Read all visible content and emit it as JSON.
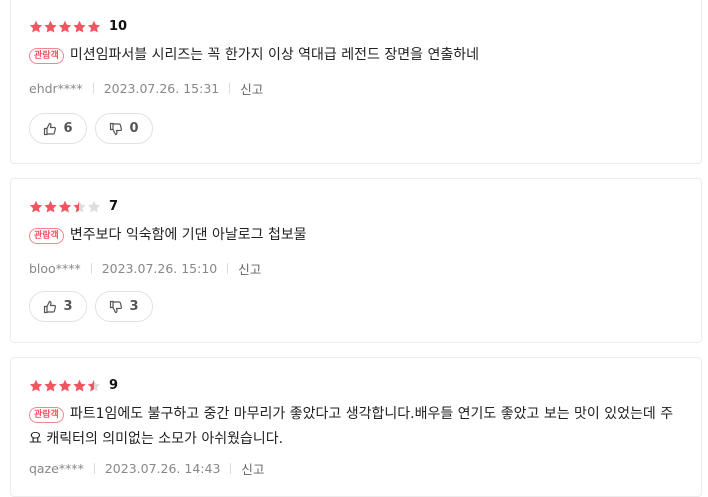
{
  "colors": {
    "star": "#f15561",
    "star_empty": "#dddddd",
    "badge": "#f15561"
  },
  "reviews": [
    {
      "rating_fraction": 1.0,
      "score": "10",
      "badge": "관람객",
      "comment": "미션임파서블 시리즈는 꼭 한가지 이상 역대급 레전드 장면을 연출하네",
      "user": "ehdr****",
      "date": "2023.07.26. 15:31",
      "report": "신고",
      "likes": "6",
      "dislikes": "0"
    },
    {
      "rating_fraction": 0.7,
      "score": "7",
      "badge": "관람객",
      "comment": "변주보다 익숙함에 기댄 아날로그 첩보물",
      "user": "bloo****",
      "date": "2023.07.26. 15:10",
      "report": "신고",
      "likes": "3",
      "dislikes": "3"
    },
    {
      "rating_fraction": 0.9,
      "score": "9",
      "badge": "관람객",
      "comment": "파트1임에도 불구하고 중간 마무리가 좋았다고 생각합니다.배우들 연기도 좋았고 보는 맛이 있었는데 주요 캐릭터의 의미없는 소모가 아쉬웠습니다.",
      "user": "qaze****",
      "date": "2023.07.26. 14:43",
      "report": "신고"
    }
  ]
}
